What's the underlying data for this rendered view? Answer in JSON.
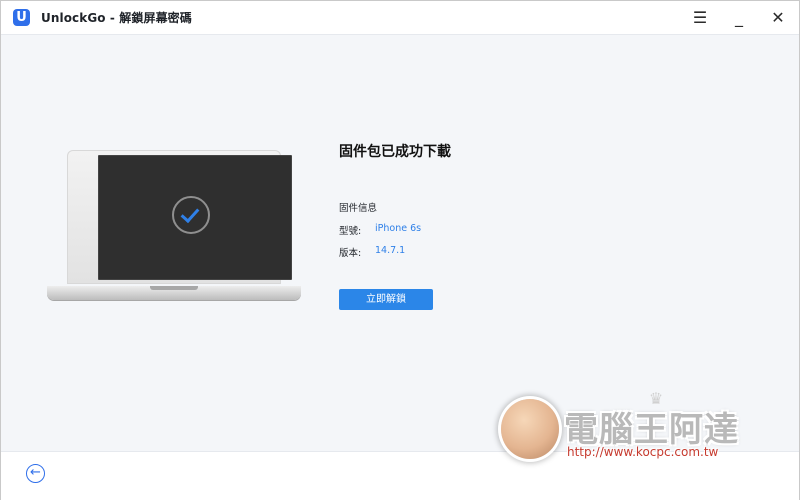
{
  "window": {
    "title": "UnlockGo - 解鎖屏幕密碼",
    "logo_text": "U",
    "controls": {
      "menu_icon": "☰",
      "minimize_icon": "_",
      "close_icon": "✕"
    }
  },
  "main": {
    "heading": "固件包已成功下載",
    "firmware_info": {
      "title": "固件信息",
      "model_label": "型號:",
      "model_value": "iPhone 6s",
      "version_label": "版本:",
      "version_value": "14.7.1"
    },
    "unlock_button": "立即解鎖"
  },
  "footer": {
    "back_icon": "←"
  },
  "watermark": {
    "text": "電腦王阿達",
    "url": "http://www.kocpc.com.tw",
    "crown": "♛"
  },
  "colors": {
    "accent": "#2b86e8",
    "background": "#f4f6f9",
    "text": "#1f2329"
  },
  "icons": {
    "app_logo": "unlockgo-logo",
    "menu": "menu-icon",
    "minimize": "minimize-icon",
    "close": "close-icon",
    "success": "check-icon",
    "back": "back-arrow-icon"
  }
}
